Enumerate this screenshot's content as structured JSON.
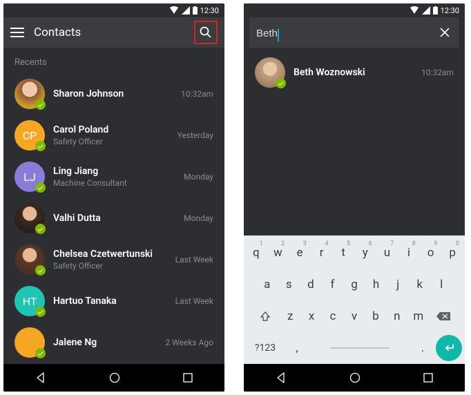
{
  "status": {
    "time": "12:30"
  },
  "left": {
    "title": "Contacts",
    "section": "Recents",
    "contacts": [
      {
        "name": "Sharon Johnson",
        "sub": "",
        "time": "10:32am",
        "initials": "",
        "color": "#d49a27",
        "photo": "av-photo1"
      },
      {
        "name": "Carol Poland",
        "sub": "Safety Officer",
        "time": "Yesterday",
        "initials": "CP",
        "color": "#f5a623",
        "photo": ""
      },
      {
        "name": "Ling Jiang",
        "sub": "Machine Consultant",
        "time": "Monday",
        "initials": "LJ",
        "color": "#8a7bd8",
        "photo": ""
      },
      {
        "name": "Valhi Dutta",
        "sub": "",
        "time": "Monday",
        "initials": "",
        "color": "#3a2a20",
        "photo": "av-photo2"
      },
      {
        "name": "Chelsea Czetwertunski",
        "sub": "Safety Officer",
        "time": "Last Week",
        "initials": "",
        "color": "#5a3828",
        "photo": "av-photo3"
      },
      {
        "name": "Hartuo Tanaka",
        "sub": "",
        "time": "Last Week",
        "initials": "HT",
        "color": "#1fc4b4",
        "photo": ""
      },
      {
        "name": "Jalene Ng",
        "sub": "",
        "time": "2 Weeks Ago",
        "initials": "",
        "color": "#f5a623",
        "photo": ""
      }
    ]
  },
  "right": {
    "query": "Beth",
    "results": [
      {
        "name": "Beth Woznowski",
        "time": "10:32am",
        "photo": "av-photo4"
      }
    ],
    "keyboard": {
      "row1": [
        "q",
        "w",
        "e",
        "r",
        "t",
        "y",
        "u",
        "i",
        "o",
        "p"
      ],
      "hints": [
        "1",
        "2",
        "3",
        "4",
        "5",
        "6",
        "7",
        "8",
        "9",
        "0"
      ],
      "row2": [
        "a",
        "s",
        "d",
        "f",
        "g",
        "h",
        "j",
        "k",
        "l"
      ],
      "row3": [
        "z",
        "x",
        "c",
        "v",
        "b",
        "n",
        "m"
      ],
      "sym": "?123",
      "comma": ",",
      "period": "."
    }
  }
}
